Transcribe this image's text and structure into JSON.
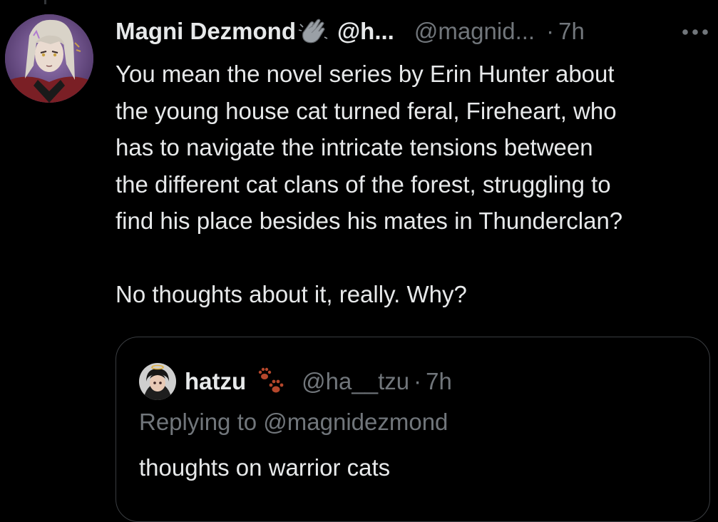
{
  "tweet": {
    "display_name": "Magni Dezmond",
    "name_emoji_icon": "clapping-hands-icon",
    "name_suffix": "@h...",
    "handle": "@magnid...",
    "separator": "·",
    "time": "7h",
    "more_icon": "more-horizontal-icon",
    "body_lines_p1": [
      "You mean the novel series by Erin Hunter about",
      "the young house cat turned feral, Fireheart, who",
      "has to navigate the intricate tensions between",
      "the different cat clans of the forest, struggling to",
      "find his place besides his mates in Thunderclan?"
    ],
    "body_p2": "No thoughts about it, really. Why?"
  },
  "quoted": {
    "display_name": "hatzu",
    "name_emoji_icon": "paw-prints-icon",
    "handle": "@ha__tzu",
    "separator": "·",
    "time": "7h",
    "replying_to": "Replying to @magnidezmond",
    "text": "thoughts on warrior cats"
  },
  "colors": {
    "background": "#000000",
    "primary_text": "#e7e9ea",
    "secondary_text": "#71767b",
    "border": "#3a3d41",
    "paw_color": "#b5472c"
  }
}
